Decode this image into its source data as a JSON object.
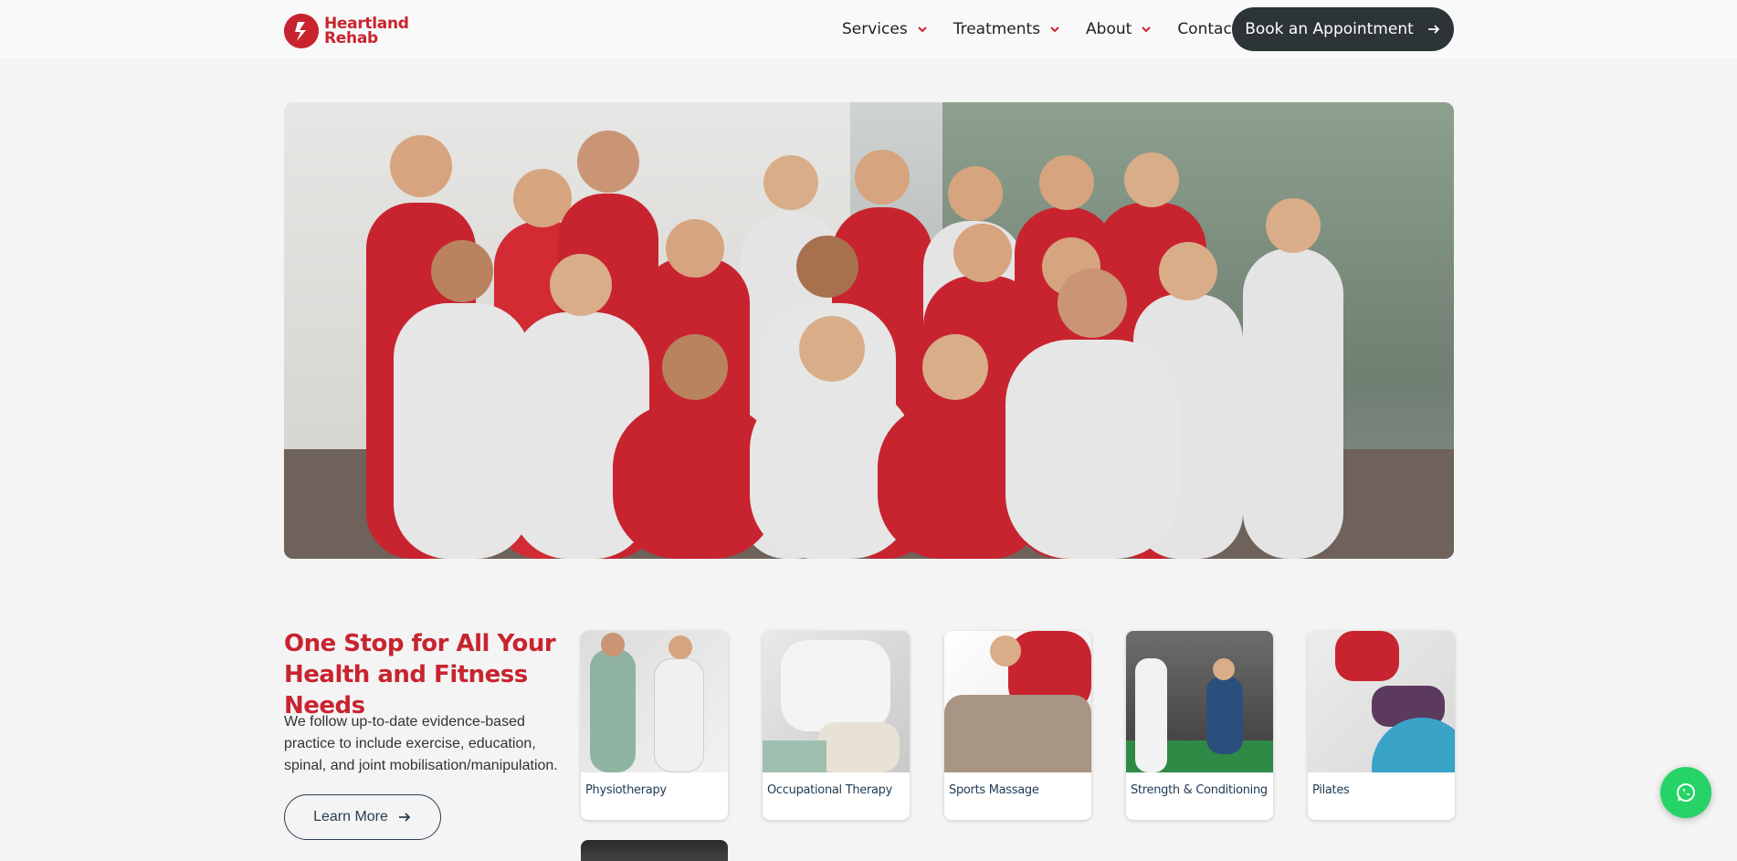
{
  "brand": {
    "name_line1": "Heartland",
    "name_line2": "Rehab",
    "color": "#c8242f"
  },
  "nav": {
    "items": [
      {
        "label": "Services",
        "has_dropdown": true
      },
      {
        "label": "Treatments",
        "has_dropdown": true
      },
      {
        "label": "About",
        "has_dropdown": true
      },
      {
        "label": "Contact",
        "has_dropdown": false
      }
    ],
    "cta_label": "Book an Appointment"
  },
  "hero": {
    "image": "team-photo"
  },
  "services": {
    "title": "One Stop for All Your Health and Fitness Needs",
    "description": "We follow up-to-date evidence-based practice to include exercise, education, spinal, and joint mobilisation/manipulation.",
    "learn_more_label": "Learn More",
    "cards": [
      {
        "label": "Physiotherapy"
      },
      {
        "label": "Occupational Therapy"
      },
      {
        "label": "Sports Massage"
      },
      {
        "label": "Strength & Conditioning"
      },
      {
        "label": "Pilates"
      }
    ]
  },
  "icons": {
    "dropdown": "chevron-down-icon",
    "arrow": "arrow-right-icon",
    "chat": "whatsapp-icon"
  },
  "colors": {
    "accent": "#c8242f",
    "dark_button": "#2c3437",
    "whatsapp": "#25d366",
    "card_label": "#1f3a52"
  }
}
